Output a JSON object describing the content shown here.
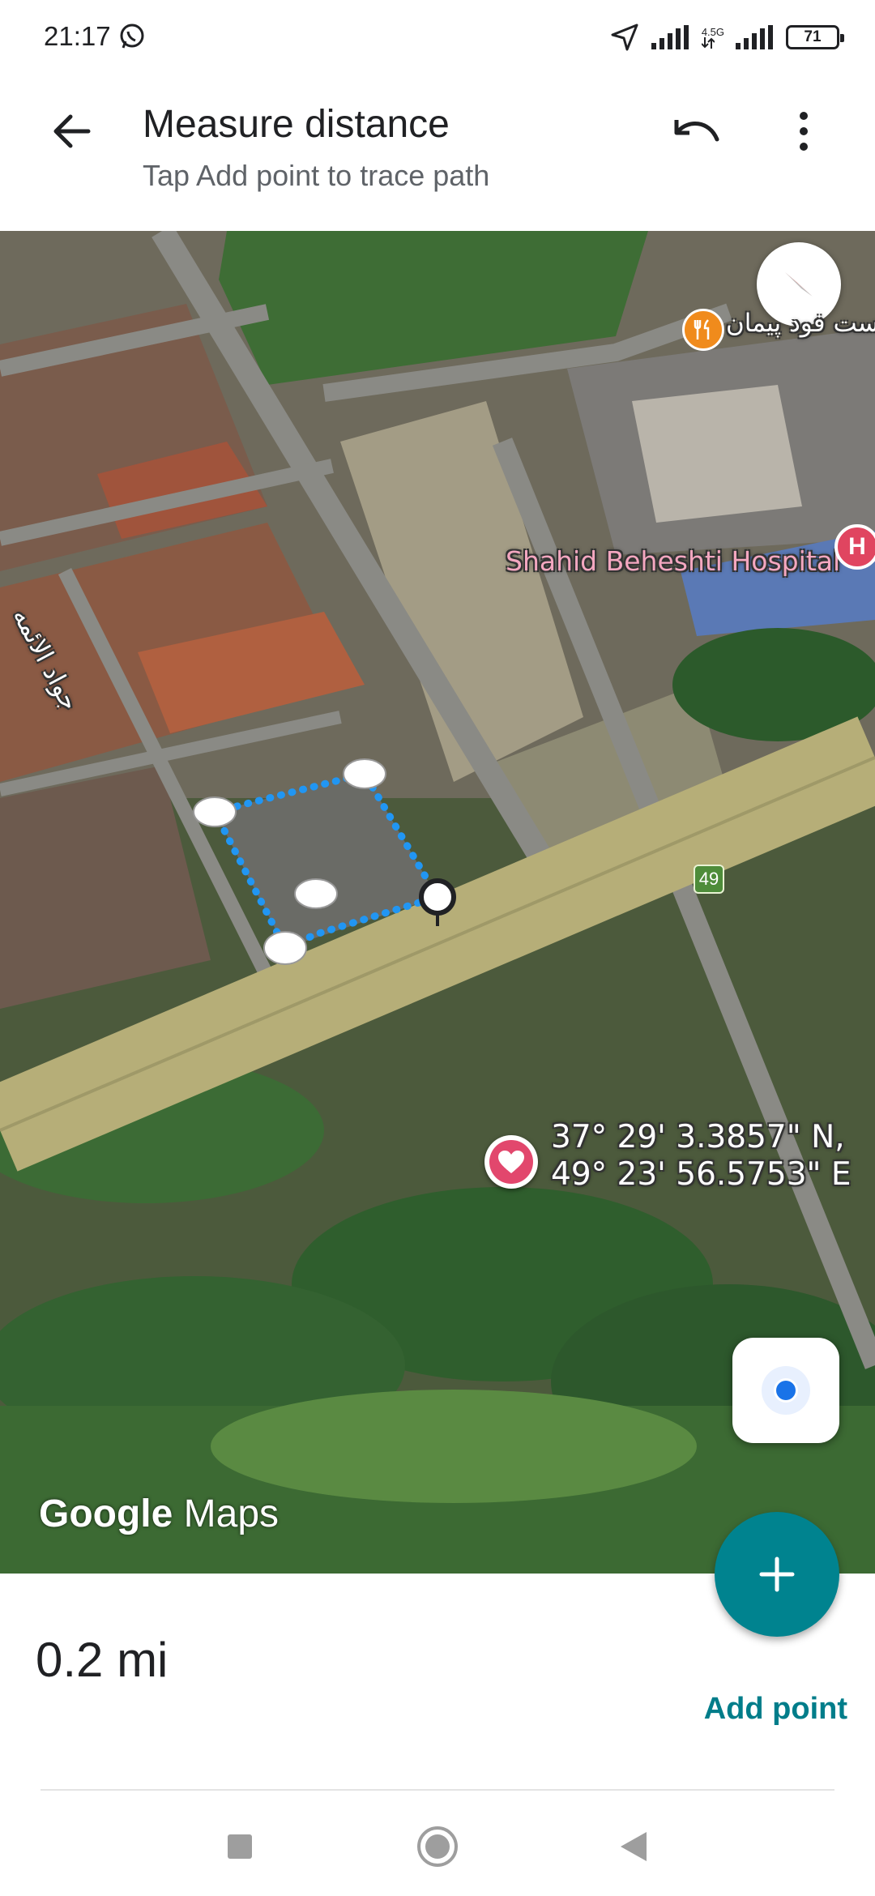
{
  "status_bar": {
    "time": "21:17",
    "network": "4.5G",
    "battery": "71"
  },
  "header": {
    "title": "Measure distance",
    "subtitle": "Tap Add point to trace path"
  },
  "map": {
    "hospital_label": "Shahid Beheshti Hospital",
    "hospital_pin": "H",
    "restaurant_label": "ست فود پیمان",
    "street_label": "جواد الائمه",
    "route_number": "49",
    "coordinates_line1": "37° 29' 3.3857\" N,",
    "coordinates_line2": "49° 23' 56.5753\" E",
    "logo_google": "Google",
    "logo_maps": "Maps",
    "icons": {
      "compass": "compass-icon",
      "location": "my-location-icon",
      "favorite": "heart-icon",
      "restaurant": "fork-knife-icon"
    }
  },
  "bottom_panel": {
    "distance": "0.2 mi",
    "add_point_label": "Add point"
  },
  "colors": {
    "accent_teal": "#00838f",
    "link_teal": "#007d8a",
    "path_blue": "#2196f3",
    "hospital_red": "#e04560"
  }
}
